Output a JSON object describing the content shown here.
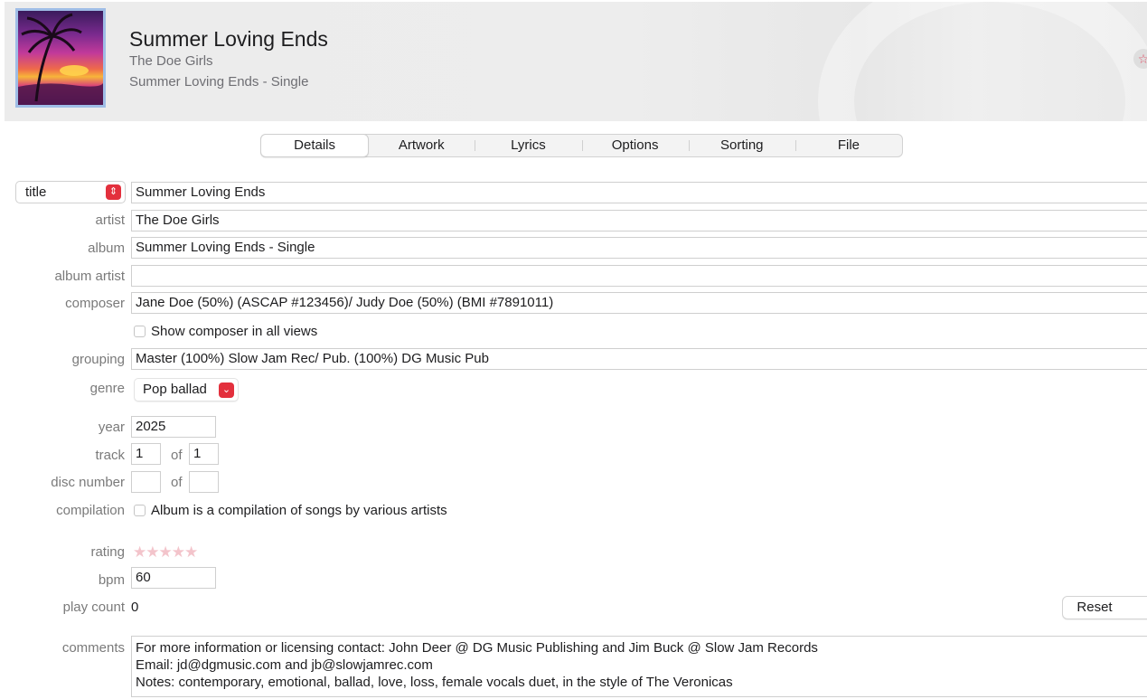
{
  "header": {
    "title": "Summer Loving Ends",
    "artist": "The Doe Girls",
    "album": "Summer Loving Ends - Single",
    "favorite_icon": "star-icon",
    "favorite_glyph": "☆"
  },
  "tabs": [
    {
      "label": "Details",
      "active": true
    },
    {
      "label": "Artwork",
      "active": false
    },
    {
      "label": "Lyrics",
      "active": false
    },
    {
      "label": "Options",
      "active": false
    },
    {
      "label": "Sorting",
      "active": false
    },
    {
      "label": "File",
      "active": false
    }
  ],
  "form": {
    "title_selector": "title",
    "title_value": "Summer Loving Ends",
    "artist_label": "artist",
    "artist_value": "The Doe Girls",
    "album_label": "album",
    "album_value": "Summer Loving Ends - Single",
    "album_artist_label": "album artist",
    "album_artist_value": "",
    "composer_label": "composer",
    "composer_value": "Jane Doe (50%) (ASCAP #123456)/ Judy Doe (50%) (BMI #7891011)",
    "show_composer_label": "Show composer in all views",
    "show_composer_checked": false,
    "grouping_label": "grouping",
    "grouping_value": "Master (100%) Slow Jam Rec/ Pub. (100%) DG Music Pub",
    "genre_label": "genre",
    "genre_value": "Pop ballad",
    "year_label": "year",
    "year_value": "2025",
    "track_label": "track",
    "track_number": "1",
    "of_label": "of",
    "track_total": "1",
    "disc_label": "disc number",
    "disc_number": "",
    "disc_total": "",
    "compilation_label": "compilation",
    "compilation_text": "Album is a compilation of songs by various artists",
    "compilation_checked": false,
    "rating_label": "rating",
    "rating_value": 0,
    "rating_max": 5,
    "bpm_label": "bpm",
    "bpm_value": "60",
    "play_count_label": "play count",
    "play_count_value": "0",
    "reset_label": "Reset",
    "comments_label": "comments",
    "comments_lines": [
      "For more information or licensing contact: John Deer @ DG Music Publishing and Jim Buck @ Slow Jam Records",
      "Email: jd@dgmusic.com and jb@slowjamrec.com",
      "Notes: contemporary, emotional, ballad, love, loss, female vocals duet, in the style of The Veronicas"
    ]
  },
  "colors": {
    "accent_red": "#e3303d",
    "stars_empty": "#f3c4cb"
  }
}
